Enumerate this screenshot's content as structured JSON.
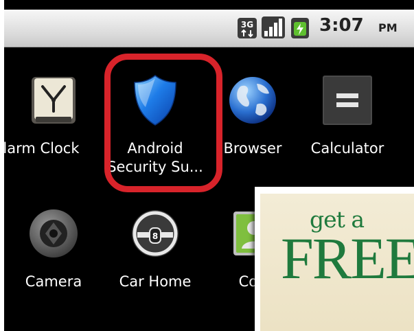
{
  "status_bar": {
    "network_icon": "3g-data-icon",
    "signal_icon": "signal-strength-icon",
    "battery_icon": "battery-charging-icon",
    "time": "3:07",
    "ampm": "PM"
  },
  "apps": [
    {
      "label": "Alarm Clock",
      "icon": "alarm-clock-icon"
    },
    {
      "label": "Android\nSecurity Su...",
      "line1": "Android",
      "line2": "Security Su...",
      "icon": "shield-icon"
    },
    {
      "label": "Browser",
      "icon": "globe-icon"
    },
    {
      "label": "Calculator",
      "icon": "calculator-icon"
    },
    {
      "label": "Camera",
      "icon": "camera-icon"
    },
    {
      "label": "Car Home",
      "icon": "steering-wheel-icon"
    },
    {
      "label": "Con",
      "icon": "contacts-icon"
    }
  ],
  "highlight_color": "#d8232a",
  "ad": {
    "line1": "get a",
    "line2": "FREE",
    "color": "#1f7a3d"
  }
}
